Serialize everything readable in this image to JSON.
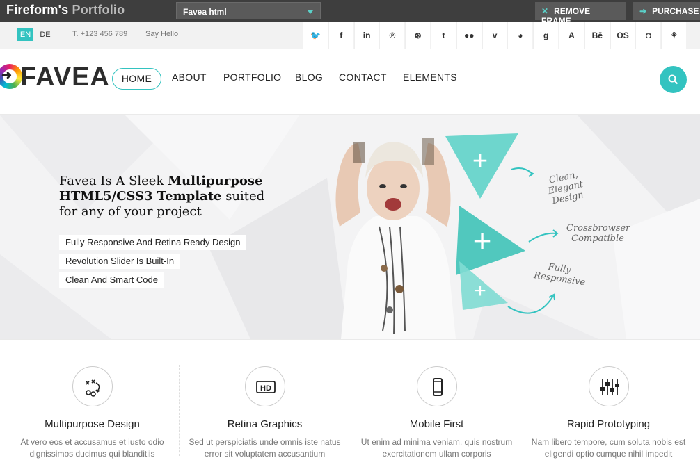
{
  "framebar": {
    "brand_main": "Fireform's",
    "brand_sub": "Portfolio",
    "theme_select_value": "Favea html",
    "remove_frame_label": "REMOVE FRAME",
    "purchase_label": "PURCHASE"
  },
  "utilbar": {
    "lang_en": "EN",
    "lang_de": "DE",
    "phone": "T. +123 456 789",
    "say_hello": "Say Hello",
    "social": [
      {
        "name": "twitter-icon",
        "glyph": "🐦"
      },
      {
        "name": "facebook-icon",
        "glyph": "f"
      },
      {
        "name": "linkedin-icon",
        "glyph": "in"
      },
      {
        "name": "pinterest-icon",
        "glyph": "℗"
      },
      {
        "name": "dribbble-icon",
        "glyph": "⊛"
      },
      {
        "name": "tumblr-icon",
        "glyph": "t"
      },
      {
        "name": "flickr-icon",
        "glyph": "●●"
      },
      {
        "name": "vimeo-icon",
        "glyph": "v"
      },
      {
        "name": "picasa-icon",
        "glyph": "◕"
      },
      {
        "name": "google-icon",
        "glyph": "g"
      },
      {
        "name": "aim-icon",
        "glyph": "A"
      },
      {
        "name": "behance-icon",
        "glyph": "Bē"
      },
      {
        "name": "lastfm-icon",
        "glyph": "OS"
      },
      {
        "name": "evernote-icon",
        "glyph": "◘"
      },
      {
        "name": "deviantart-icon",
        "glyph": "⚘"
      }
    ]
  },
  "navbar": {
    "logo_text": "FAVEA",
    "items": [
      "HOME",
      "ABOUT",
      "PORTFOLIO",
      "BLOG",
      "CONTACT",
      "ELEMENTS"
    ]
  },
  "hero": {
    "title_part1": "Favea Is A Sleek ",
    "title_bold1": "Multipurpose HTML5/CSS3 Template",
    "title_part2": " suited for any of your project",
    "features": [
      "Fully Responsive And Retina Ready Design",
      "Revolution Slider Is Built-In",
      "Clean And Smart Code"
    ],
    "tags": [
      "Clean, Elegant Design",
      "Crossbrowser Compatible",
      "Fully Responsive"
    ]
  },
  "features": [
    {
      "title": "Multipurpose Design",
      "text": "At vero eos et accusamus et iusto odio dignissimos ducimus qui blanditiis",
      "icon": "strategy-icon"
    },
    {
      "title": "Retina Graphics",
      "text": "Sed ut perspiciatis unde omnis iste natus error sit voluptatem accusantium",
      "icon": "hd-icon"
    },
    {
      "title": "Mobile First",
      "text": "Ut enim ad minima veniam, quis nostrum exercitationem ullam corporis",
      "icon": "mobile-icon"
    },
    {
      "title": "Rapid Prototyping",
      "text": "Nam libero tempore, cum soluta nobis est eligendi optio cumque nihil impedit",
      "icon": "sliders-icon"
    }
  ],
  "colors": {
    "accent": "#33c3c0",
    "framebar": "#3e3e3e",
    "utilbar": "#f2f2f2"
  }
}
